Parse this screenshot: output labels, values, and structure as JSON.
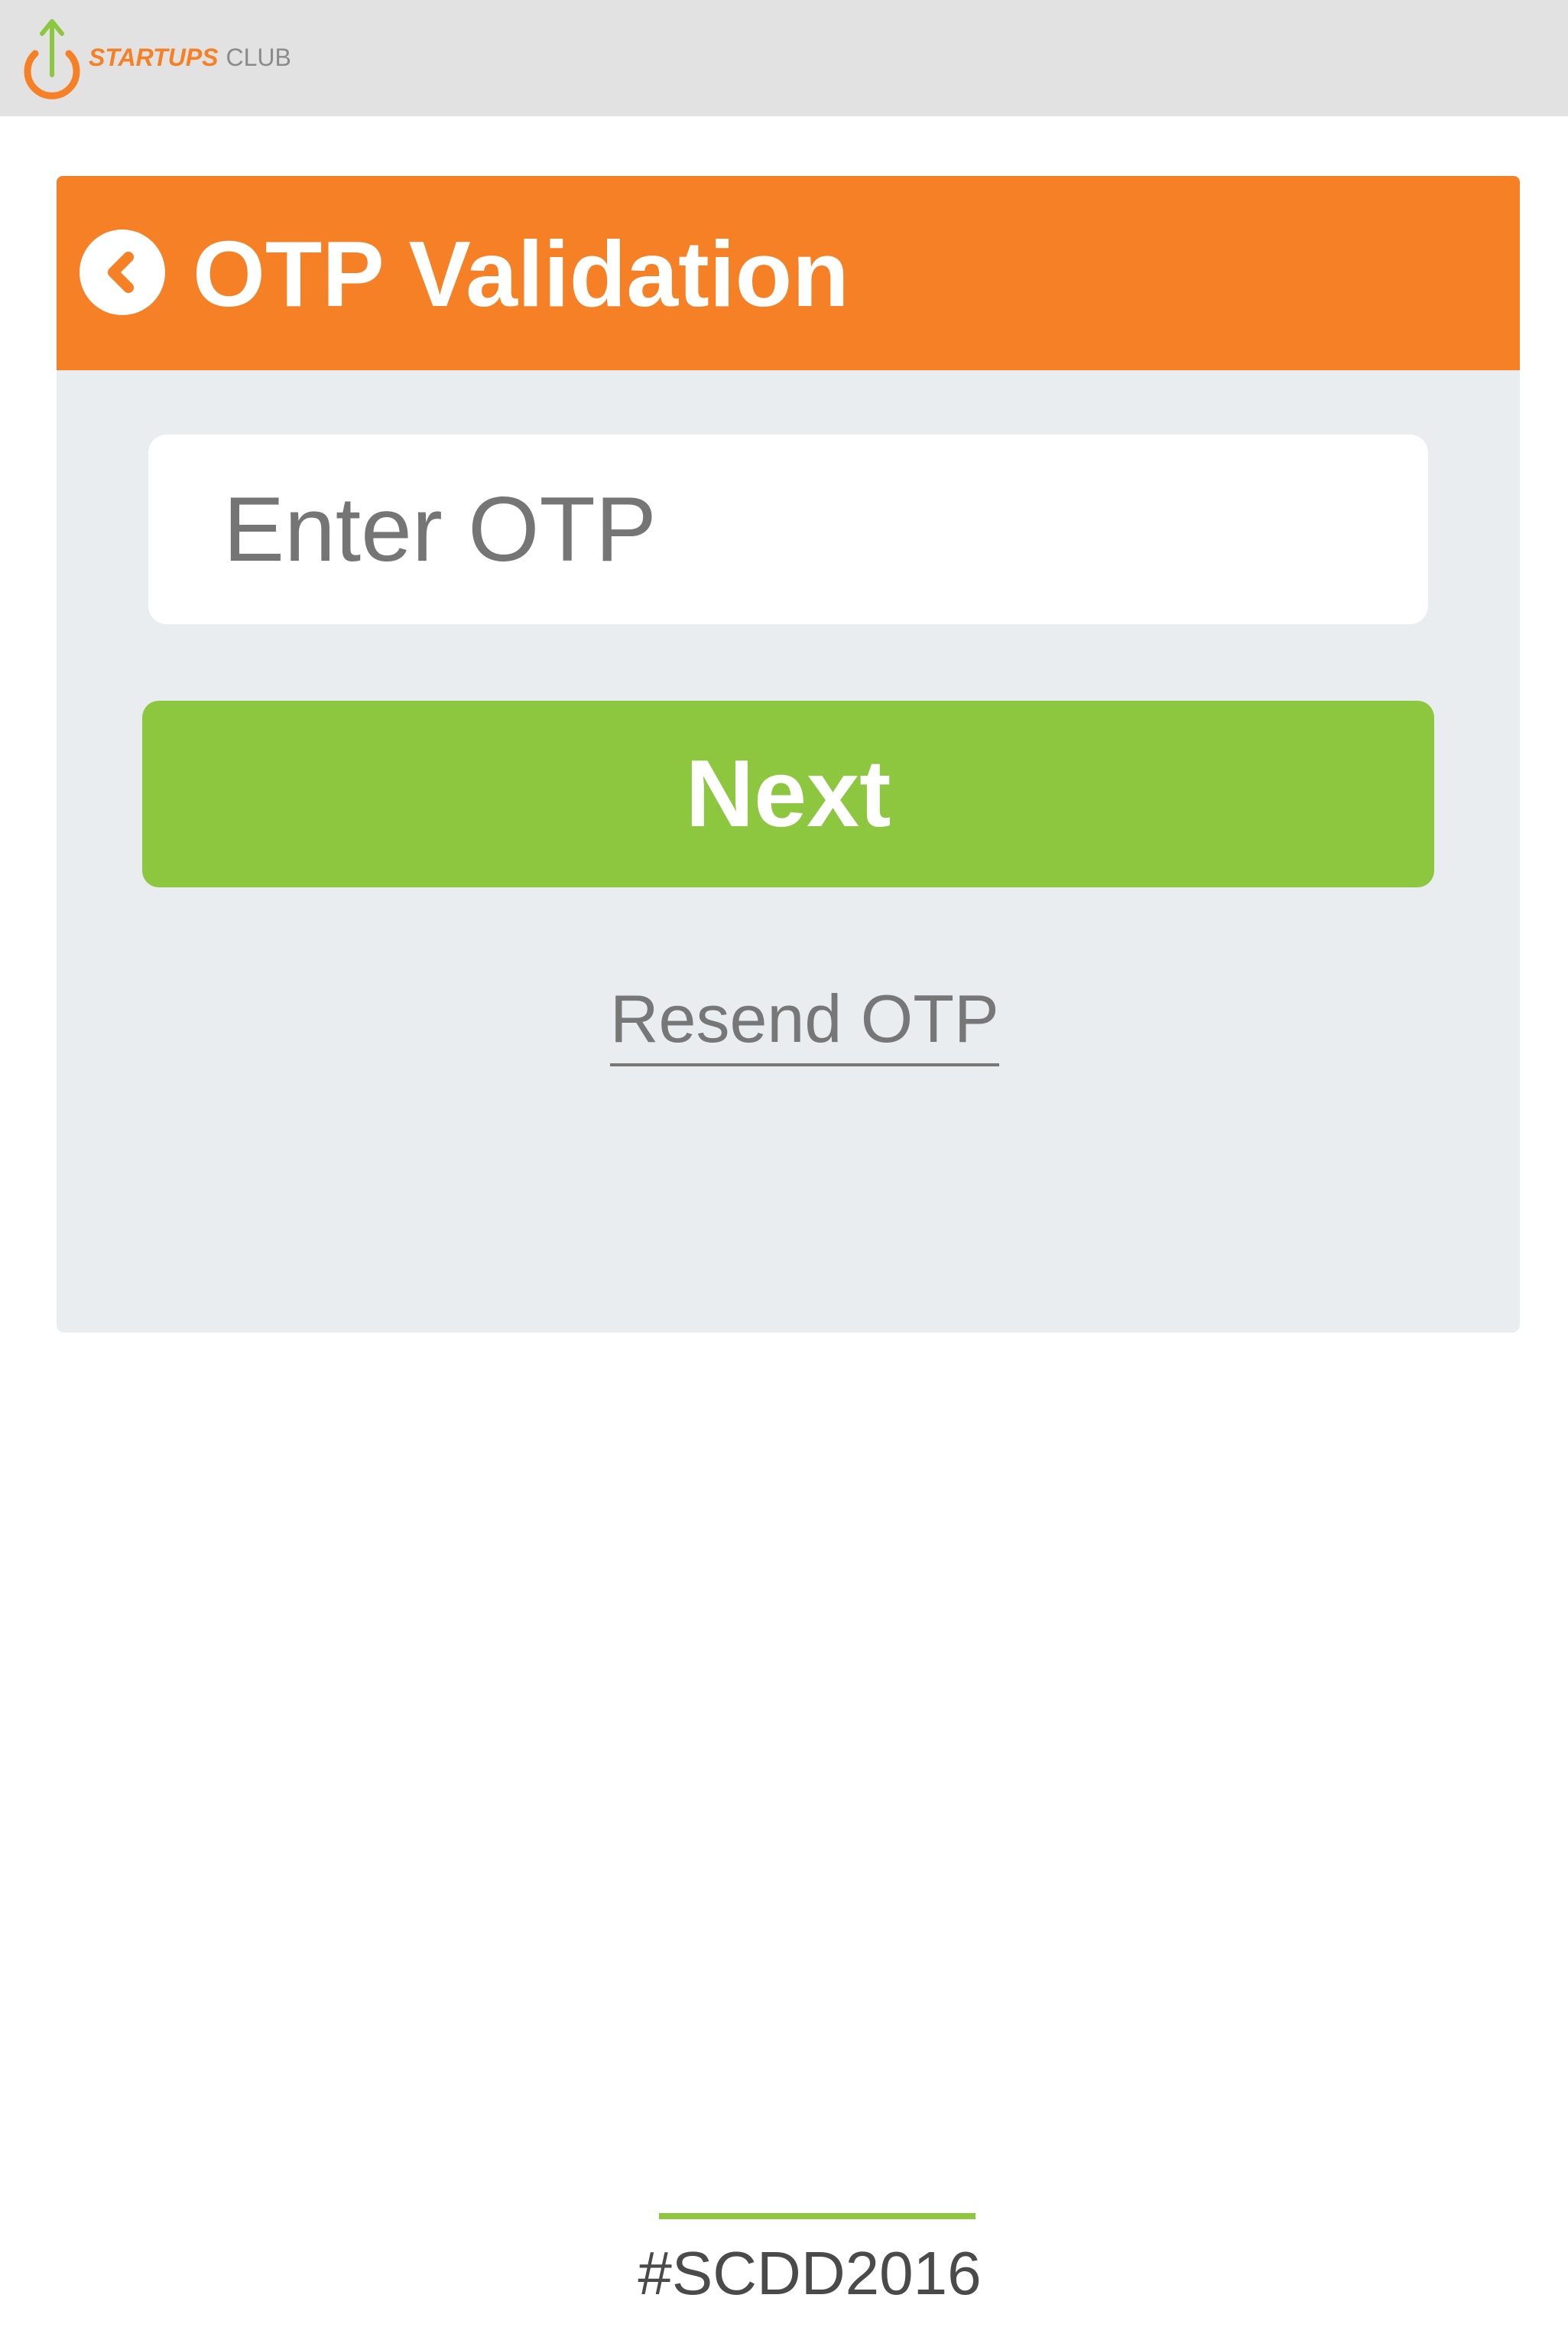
{
  "header": {
    "logo": {
      "word1": "STARTUPS",
      "word2": "CLUB",
      "icon": "power-arrow-icon"
    }
  },
  "otp_card": {
    "title": "OTP Validation",
    "back_icon": "chevron-left-icon",
    "otp_input": {
      "placeholder": "Enter OTP",
      "value": ""
    },
    "next_label": "Next",
    "resend_label": "Resend OTP"
  },
  "footer": {
    "hashtag": "#SCDD2016"
  },
  "colors": {
    "brand_orange": "#f58025",
    "brand_green": "#8dc63f",
    "topbar_bg": "#e2e2e2",
    "card_bg": "#e9edf0",
    "muted_text": "#777777"
  }
}
